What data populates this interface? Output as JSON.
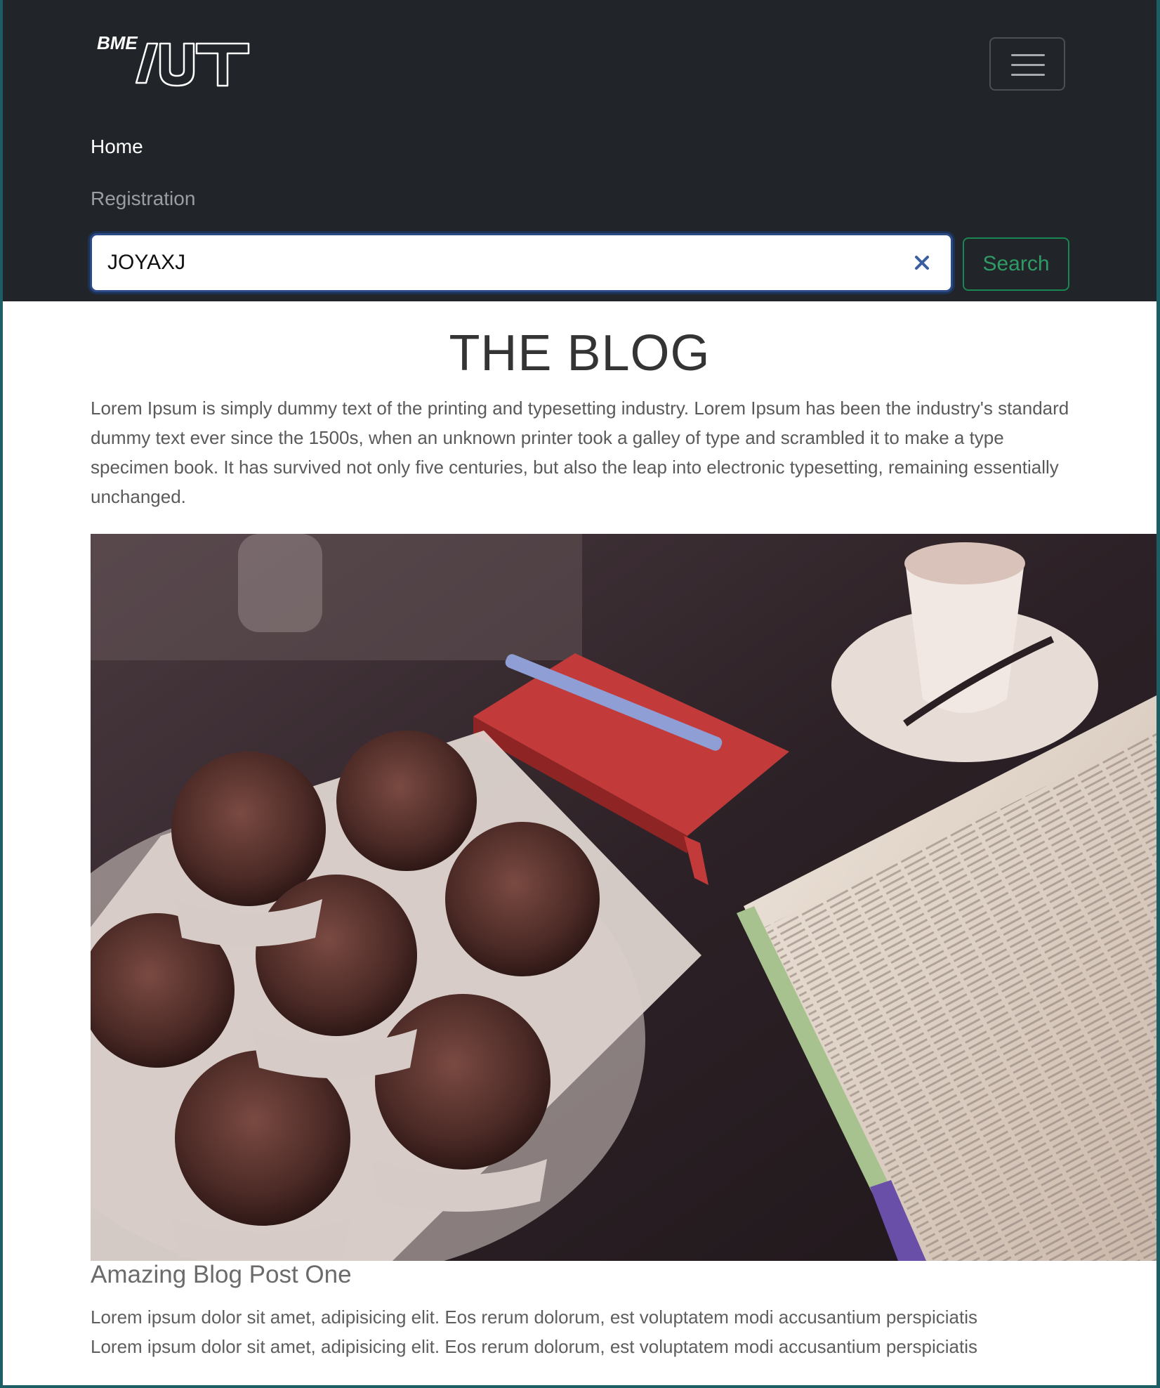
{
  "navbar": {
    "brand": {
      "prefix": "BME",
      "mark": "/UT"
    },
    "toggler_label": "Toggle navigation",
    "links": [
      {
        "label": "Home"
      },
      {
        "label": "Registration"
      }
    ],
    "search": {
      "value": "JOYAXJ",
      "button_label": "Search"
    }
  },
  "main": {
    "title": "THE BLOG",
    "intro": "Lorem Ipsum is simply dummy text of the printing and typesetting industry. Lorem Ipsum has been the industry's standard dummy text ever since the 1500s, when an unknown printer took a galley of type and scrambled it to make a type specimen book. It has survived not only five centuries, but also the leap into electronic typesetting, remaining essentially unchanged.",
    "post": {
      "title": "Amazing Blog Post One",
      "lines": [
        "Lorem ipsum dolor sit amet, adipisicing elit. Eos rerum dolorum, est voluptatem modi accusantium perspiciatis",
        "Lorem ipsum dolor sit amet, adipisicing elit. Eos rerum dolorum, est voluptatem modi accusantium perspiciatis"
      ]
    }
  },
  "colors": {
    "navbar_bg": "#212529",
    "accent_success": "#198754",
    "focus_border": "#2b4a86",
    "text": "#5a5a5a"
  }
}
